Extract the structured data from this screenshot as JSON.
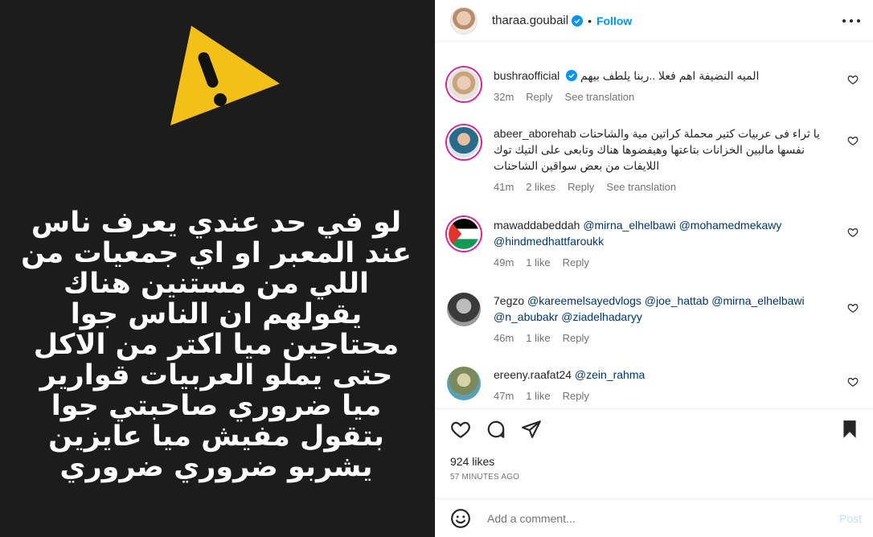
{
  "story": {
    "lines": [
      "لو في حد عندي يعرف ناس",
      "عند المعبر او اي جمعيات من",
      "اللي من مستنين هناك",
      "يقولهم ان الناس جوا",
      "محتاجين ميا اكتر من الاكل",
      "حتى يملو العربيات قوارير",
      "ميا ضروري صاحبتي جوا",
      "بتقول مفيش ميا عايزين",
      "يشربو ضروري ضروري"
    ],
    "warning_icon": "warning-triangle-icon"
  },
  "header": {
    "username": "tharaa.goubail",
    "dot": "•",
    "follow_label": "Follow"
  },
  "comments": [
    {
      "user": "bushraofficial",
      "verified": true,
      "text": "الميه النضيفة اهم فعلا ..ربنا يلطف بيهم",
      "time": "32m",
      "likes": "",
      "reply": "Reply",
      "translate": "See translation"
    },
    {
      "user": "abeer_aborehab",
      "verified": false,
      "text": "يا ثراء فى عربيات كتير محملة كراتين مية والشاحنات نفسها مالبين الخزانات بتاعتها وهيفضوها هناك وتابعى على التيك توك اللايفات من بعض سواقين الشاحنات",
      "time": "41m",
      "likes": "2 likes",
      "reply": "Reply",
      "translate": "See translation"
    },
    {
      "user": "mawaddabeddah",
      "verified": false,
      "text": "@mirna_elhelbawi @mohamedmekawy @hindmedhattfaroukk",
      "time": "49m",
      "likes": "1 like",
      "reply": "Reply",
      "translate": ""
    },
    {
      "user": "7egzo",
      "verified": false,
      "text": "@kareemelsayedvlogs @joe_hattab @mirna_elhelbawi @n_abubakr @ziadelhadaryy",
      "time": "46m",
      "likes": "1 like",
      "reply": "Reply",
      "translate": ""
    },
    {
      "user": "ereeny.raafat24",
      "verified": false,
      "text": "@zein_rahma",
      "time": "47m",
      "likes": "1 like",
      "reply": "Reply",
      "translate": ""
    }
  ],
  "footer": {
    "likes": "924 likes",
    "time": "57 MINUTES AGO",
    "comment_placeholder": "Add a comment...",
    "post_label": "Post"
  },
  "colors": {
    "accent": "#0095f6",
    "verified": "#0095f6",
    "mention": "#00376b",
    "media_bg": "#1c1c1c",
    "warning": "#f5c518"
  }
}
